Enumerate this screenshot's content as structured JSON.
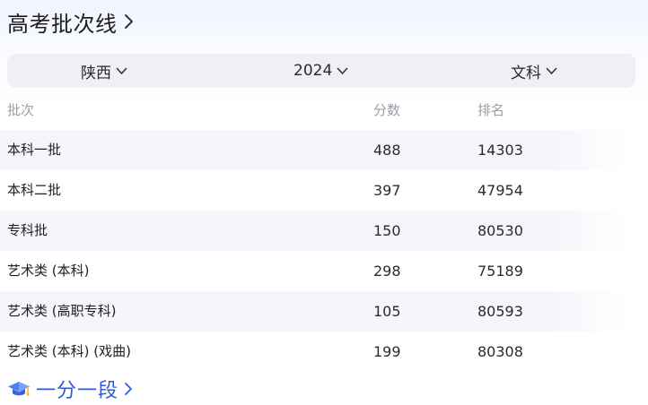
{
  "header": {
    "title": "高考批次线"
  },
  "filters": {
    "province": "陕西",
    "year": "2024",
    "subject": "文科"
  },
  "table": {
    "columns": [
      "批次",
      "分数",
      "排名"
    ],
    "rows": [
      {
        "batch": "本科一批",
        "score": "488",
        "rank": "14303"
      },
      {
        "batch": "本科二批",
        "score": "397",
        "rank": "47954"
      },
      {
        "batch": "专科批",
        "score": "150",
        "rank": "80530"
      },
      {
        "batch": "艺术类 (本科)",
        "score": "298",
        "rank": "75189"
      },
      {
        "batch": "艺术类 (高职专科)",
        "score": "105",
        "rank": "80593"
      },
      {
        "batch": "艺术类 (本科) (戏曲)",
        "score": "199",
        "rank": "80308"
      }
    ]
  },
  "footer_link": {
    "label": "一分一段",
    "icon": "graduation-cap-icon"
  },
  "colors": {
    "accent": "#2f5bd8",
    "header_text": "#9a9ea7",
    "row_shade": "#f4f6fb",
    "filter_bg": "#eef0f6"
  }
}
